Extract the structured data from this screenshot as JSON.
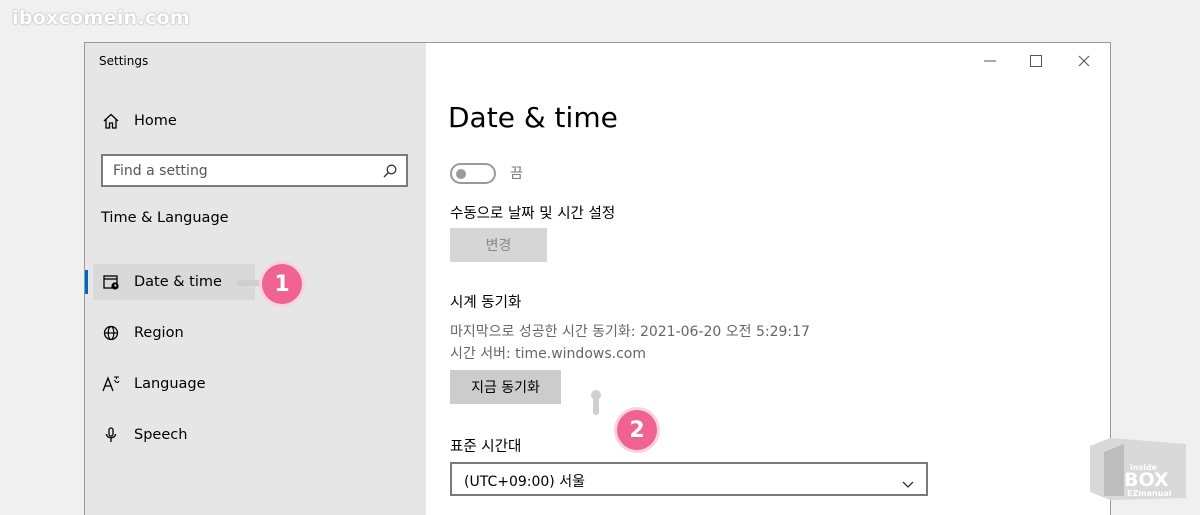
{
  "watermark": "iboxcomein.com",
  "window": {
    "title": "Settings",
    "controls": {
      "minimize_icon": "minimize-icon",
      "maximize_icon": "maximize-icon",
      "close_icon": "close-icon"
    }
  },
  "sidebar": {
    "home_label": "Home",
    "search_placeholder": "Find a setting",
    "section_label": "Time & Language",
    "items": [
      {
        "label": "Date & time",
        "icon": "calendar-clock-icon",
        "selected": true
      },
      {
        "label": "Region",
        "icon": "globe-icon"
      },
      {
        "label": "Language",
        "icon": "language-icon"
      },
      {
        "label": "Speech",
        "icon": "microphone-icon"
      }
    ]
  },
  "main": {
    "title": "Date & time",
    "auto_toggle": {
      "state_label": "끔",
      "on": false
    },
    "manual_label": "수동으로 날짜 및 시간 설정",
    "change_button": "변경",
    "sync": {
      "heading": "시계 동기화",
      "last_sync": "마지막으로 성공한 시간 동기화: 2021-06-20 오전 5:29:17",
      "server": "시간 서버: time.windows.com",
      "button": "지금 동기화"
    },
    "timezone": {
      "label": "표준 시간대",
      "value": "(UTC+09:00) 서울"
    }
  },
  "annotations": {
    "badge1": "1",
    "badge2": "2"
  },
  "logo": {
    "line1": "inside",
    "line2": "BOX",
    "line3": "EZmanual"
  },
  "colors": {
    "accent": "#0067c0",
    "badge": "#f06292"
  }
}
